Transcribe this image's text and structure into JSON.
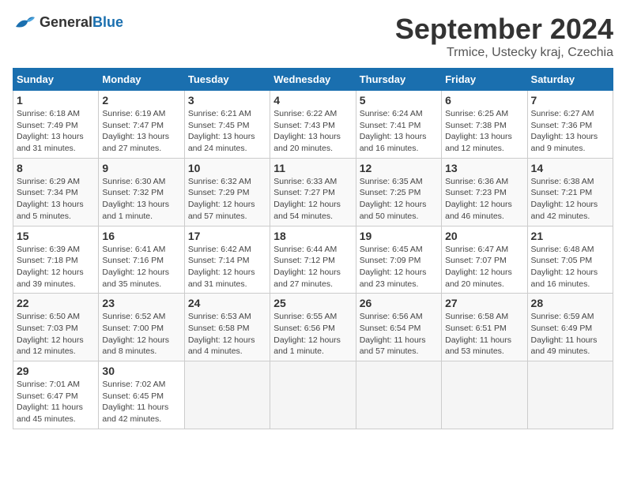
{
  "header": {
    "logo_general": "General",
    "logo_blue": "Blue",
    "month_title": "September 2024",
    "location": "Trmice, Ustecky kraj, Czechia"
  },
  "weekdays": [
    "Sunday",
    "Monday",
    "Tuesday",
    "Wednesday",
    "Thursday",
    "Friday",
    "Saturday"
  ],
  "weeks": [
    [
      {
        "day": "1",
        "info": "Sunrise: 6:18 AM\nSunset: 7:49 PM\nDaylight: 13 hours\nand 31 minutes."
      },
      {
        "day": "2",
        "info": "Sunrise: 6:19 AM\nSunset: 7:47 PM\nDaylight: 13 hours\nand 27 minutes."
      },
      {
        "day": "3",
        "info": "Sunrise: 6:21 AM\nSunset: 7:45 PM\nDaylight: 13 hours\nand 24 minutes."
      },
      {
        "day": "4",
        "info": "Sunrise: 6:22 AM\nSunset: 7:43 PM\nDaylight: 13 hours\nand 20 minutes."
      },
      {
        "day": "5",
        "info": "Sunrise: 6:24 AM\nSunset: 7:41 PM\nDaylight: 13 hours\nand 16 minutes."
      },
      {
        "day": "6",
        "info": "Sunrise: 6:25 AM\nSunset: 7:38 PM\nDaylight: 13 hours\nand 12 minutes."
      },
      {
        "day": "7",
        "info": "Sunrise: 6:27 AM\nSunset: 7:36 PM\nDaylight: 13 hours\nand 9 minutes."
      }
    ],
    [
      {
        "day": "8",
        "info": "Sunrise: 6:29 AM\nSunset: 7:34 PM\nDaylight: 13 hours\nand 5 minutes."
      },
      {
        "day": "9",
        "info": "Sunrise: 6:30 AM\nSunset: 7:32 PM\nDaylight: 13 hours\nand 1 minute."
      },
      {
        "day": "10",
        "info": "Sunrise: 6:32 AM\nSunset: 7:29 PM\nDaylight: 12 hours\nand 57 minutes."
      },
      {
        "day": "11",
        "info": "Sunrise: 6:33 AM\nSunset: 7:27 PM\nDaylight: 12 hours\nand 54 minutes."
      },
      {
        "day": "12",
        "info": "Sunrise: 6:35 AM\nSunset: 7:25 PM\nDaylight: 12 hours\nand 50 minutes."
      },
      {
        "day": "13",
        "info": "Sunrise: 6:36 AM\nSunset: 7:23 PM\nDaylight: 12 hours\nand 46 minutes."
      },
      {
        "day": "14",
        "info": "Sunrise: 6:38 AM\nSunset: 7:21 PM\nDaylight: 12 hours\nand 42 minutes."
      }
    ],
    [
      {
        "day": "15",
        "info": "Sunrise: 6:39 AM\nSunset: 7:18 PM\nDaylight: 12 hours\nand 39 minutes."
      },
      {
        "day": "16",
        "info": "Sunrise: 6:41 AM\nSunset: 7:16 PM\nDaylight: 12 hours\nand 35 minutes."
      },
      {
        "day": "17",
        "info": "Sunrise: 6:42 AM\nSunset: 7:14 PM\nDaylight: 12 hours\nand 31 minutes."
      },
      {
        "day": "18",
        "info": "Sunrise: 6:44 AM\nSunset: 7:12 PM\nDaylight: 12 hours\nand 27 minutes."
      },
      {
        "day": "19",
        "info": "Sunrise: 6:45 AM\nSunset: 7:09 PM\nDaylight: 12 hours\nand 23 minutes."
      },
      {
        "day": "20",
        "info": "Sunrise: 6:47 AM\nSunset: 7:07 PM\nDaylight: 12 hours\nand 20 minutes."
      },
      {
        "day": "21",
        "info": "Sunrise: 6:48 AM\nSunset: 7:05 PM\nDaylight: 12 hours\nand 16 minutes."
      }
    ],
    [
      {
        "day": "22",
        "info": "Sunrise: 6:50 AM\nSunset: 7:03 PM\nDaylight: 12 hours\nand 12 minutes."
      },
      {
        "day": "23",
        "info": "Sunrise: 6:52 AM\nSunset: 7:00 PM\nDaylight: 12 hours\nand 8 minutes."
      },
      {
        "day": "24",
        "info": "Sunrise: 6:53 AM\nSunset: 6:58 PM\nDaylight: 12 hours\nand 4 minutes."
      },
      {
        "day": "25",
        "info": "Sunrise: 6:55 AM\nSunset: 6:56 PM\nDaylight: 12 hours\nand 1 minute."
      },
      {
        "day": "26",
        "info": "Sunrise: 6:56 AM\nSunset: 6:54 PM\nDaylight: 11 hours\nand 57 minutes."
      },
      {
        "day": "27",
        "info": "Sunrise: 6:58 AM\nSunset: 6:51 PM\nDaylight: 11 hours\nand 53 minutes."
      },
      {
        "day": "28",
        "info": "Sunrise: 6:59 AM\nSunset: 6:49 PM\nDaylight: 11 hours\nand 49 minutes."
      }
    ],
    [
      {
        "day": "29",
        "info": "Sunrise: 7:01 AM\nSunset: 6:47 PM\nDaylight: 11 hours\nand 45 minutes."
      },
      {
        "day": "30",
        "info": "Sunrise: 7:02 AM\nSunset: 6:45 PM\nDaylight: 11 hours\nand 42 minutes."
      },
      {
        "day": "",
        "info": ""
      },
      {
        "day": "",
        "info": ""
      },
      {
        "day": "",
        "info": ""
      },
      {
        "day": "",
        "info": ""
      },
      {
        "day": "",
        "info": ""
      }
    ]
  ]
}
